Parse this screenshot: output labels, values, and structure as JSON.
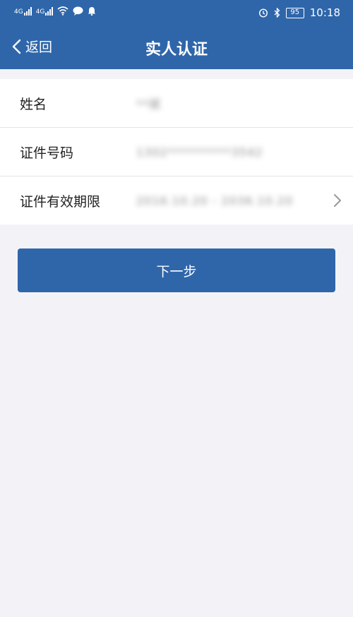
{
  "status_bar": {
    "sim1": "4G",
    "sim2": "4G",
    "battery": "95",
    "time": "10:18"
  },
  "nav": {
    "back_label": "返回",
    "title": "实人认证"
  },
  "form": {
    "rows": [
      {
        "label": "姓名",
        "value": "**斌"
      },
      {
        "label": "证件号码",
        "value": "1302**********3542"
      },
      {
        "label": "证件有效期限",
        "value": "2016.10.20 - 2036.10.20"
      }
    ]
  },
  "next_button_label": "下一步"
}
